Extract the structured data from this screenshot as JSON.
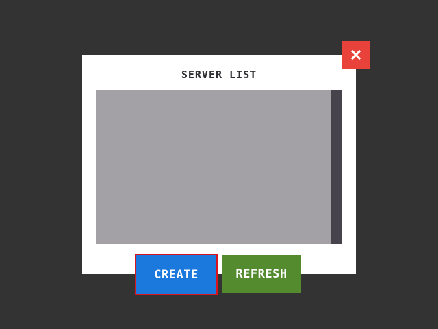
{
  "dialog": {
    "title": "SERVER LIST",
    "close_icon": "close-icon"
  },
  "server_list": {
    "items": []
  },
  "buttons": {
    "create_label": "CREATE",
    "refresh_label": "REFRESH"
  },
  "colors": {
    "background": "#333333",
    "dialog": "#ffffff",
    "list_panel": "#a4a1a6",
    "scrollbar": "#46434d",
    "close": "#e8423a",
    "create": "#1b78dc",
    "create_border": "#d8141e",
    "refresh": "#558b2f"
  }
}
